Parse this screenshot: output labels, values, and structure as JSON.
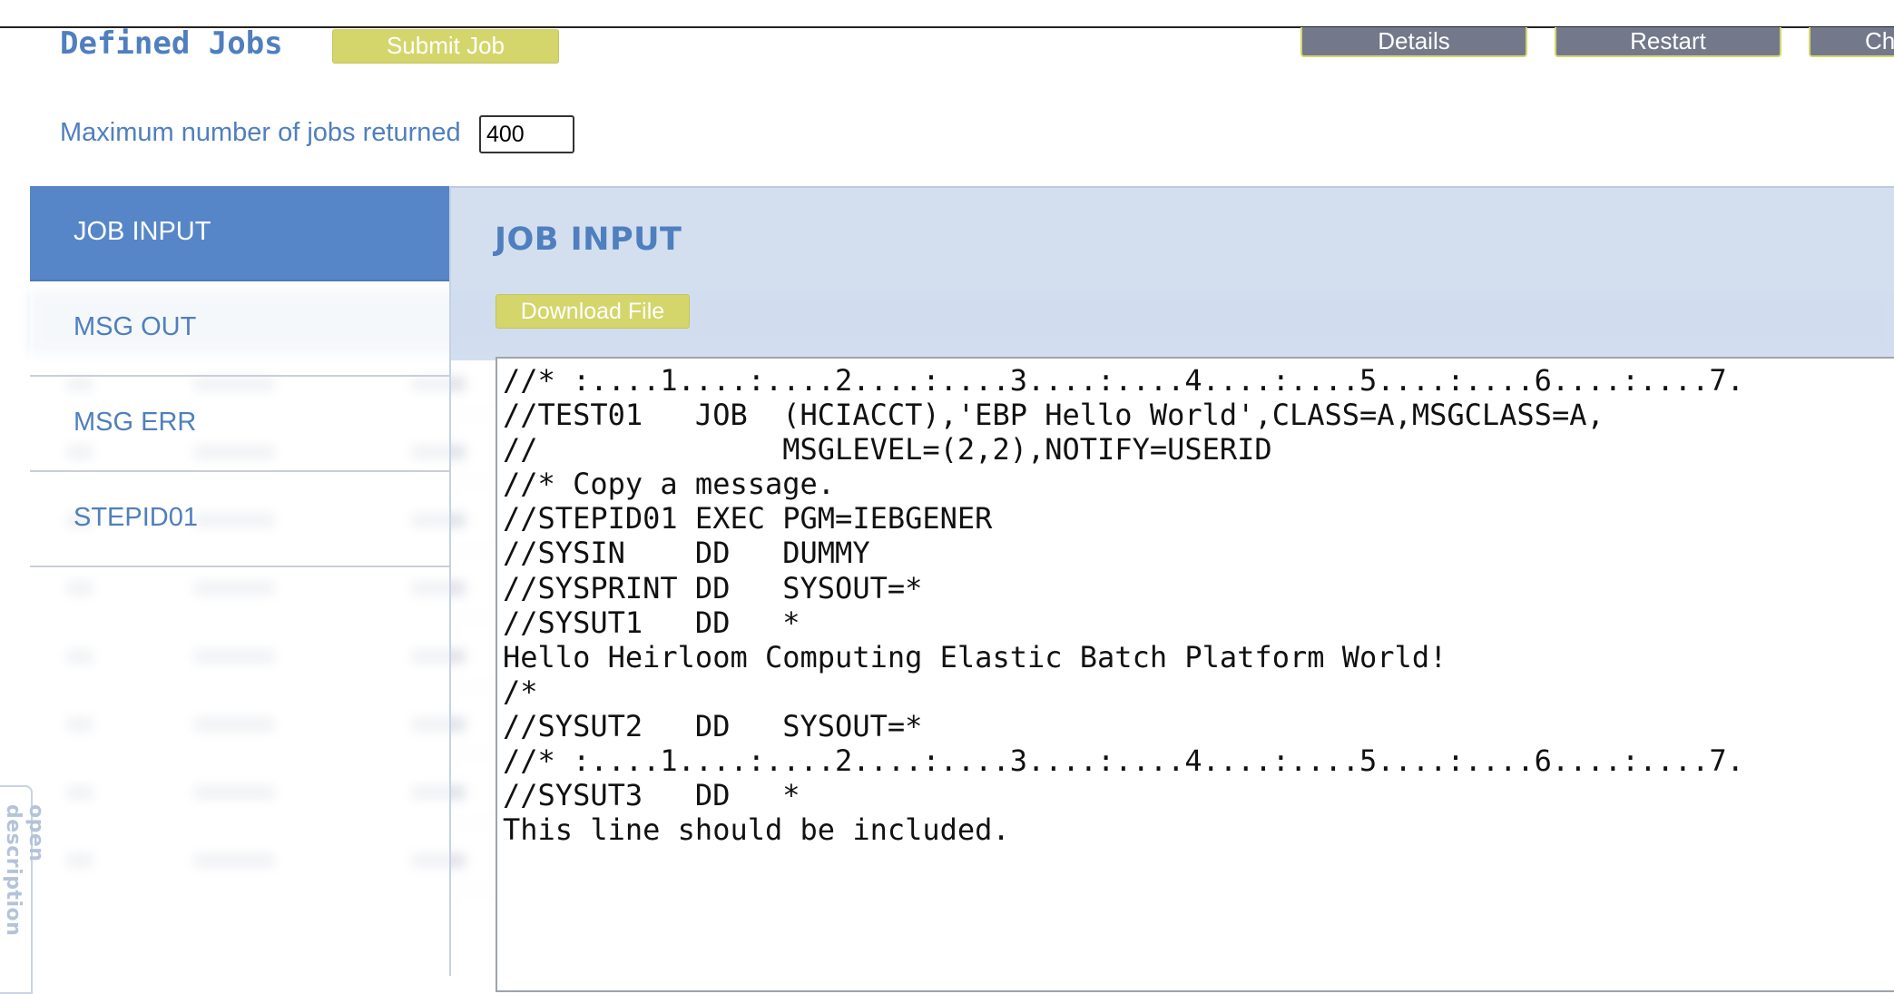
{
  "header": {
    "title": "Defined Jobs",
    "submit_label": "Submit Job",
    "details_label": "Details",
    "restart_label": "Restart",
    "change_label": "Ch"
  },
  "filter": {
    "max_jobs_label": "Maximum number of jobs returned",
    "max_jobs_value": "400"
  },
  "sidebar": {
    "items": [
      {
        "label": "JOB INPUT",
        "active": true
      },
      {
        "label": "MSG OUT",
        "active": false
      },
      {
        "label": "MSG ERR",
        "active": false
      },
      {
        "label": "STEPID01",
        "active": false
      }
    ]
  },
  "panel": {
    "title": "JOB INPUT",
    "download_label": "Download File",
    "lines": [
      "//* :....1....:....2....:....3....:....4....:....5....:....6....:....7.",
      "//TEST01   JOB  (HCIACCT),'EBP Hello World',CLASS=A,MSGCLASS=A,",
      "//              MSGLEVEL=(2,2),NOTIFY=USERID",
      "//* Copy a message.",
      "//STEPID01 EXEC PGM=IEBGENER",
      "//SYSIN    DD   DUMMY",
      "//SYSPRINT DD   SYSOUT=*",
      "//SYSUT1   DD   *",
      "Hello Heirloom Computing Elastic Batch Platform World!",
      "/*",
      "//SYSUT2   DD   SYSOUT=*",
      "//* :....1....:....2....:....3....:....4....:....5....:....6....:....7.",
      "//SYSUT3   DD   *",
      "This line should be included."
    ]
  },
  "side_tab": {
    "label": "open description"
  },
  "colors": {
    "accent_blue": "#5686c8",
    "title_blue": "#4f7fbe",
    "button_yellow": "#d4d66c",
    "button_gray": "#73798a",
    "panel_header_bg": "#cddbed"
  }
}
